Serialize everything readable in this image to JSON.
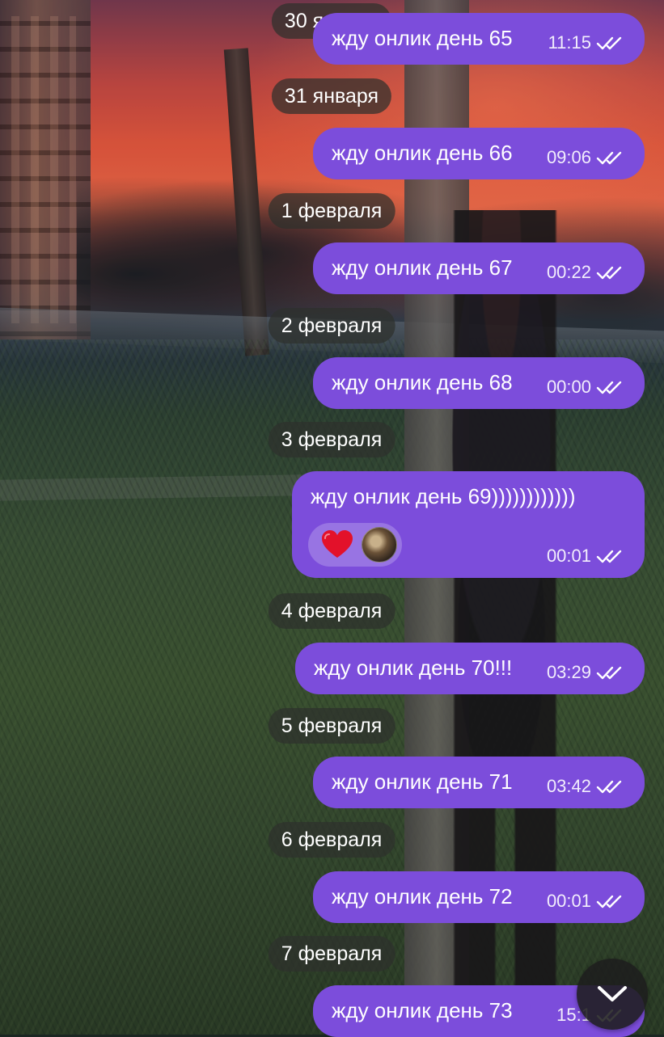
{
  "chat": {
    "entries": [
      {
        "date": "30 января",
        "message": "жду онлик день 65",
        "time": "11:15",
        "status": "read"
      },
      {
        "date": "31 января",
        "message": "жду онлик день 66",
        "time": "09:06",
        "status": "read"
      },
      {
        "date": "1 февраля",
        "message": "жду онлик день 67",
        "time": "00:22",
        "status": "read"
      },
      {
        "date": "2 февраля",
        "message": "жду онлик день 68",
        "time": "00:00",
        "status": "read"
      },
      {
        "date": "3 февраля",
        "message": "жду онлик день 69))))))))))))",
        "time": "00:01",
        "status": "read",
        "reaction": "❤️"
      },
      {
        "date": "4 февраля",
        "message": "жду онлик день 70!!!",
        "time": "03:29",
        "status": "read"
      },
      {
        "date": "5 февраля",
        "message": "жду онлик день 71",
        "time": "03:42",
        "status": "read"
      },
      {
        "date": "6 февраля",
        "message": "жду онлик день 72",
        "time": "00:01",
        "status": "read"
      },
      {
        "date": "7 февраля",
        "message": "жду онлик день 73",
        "time": "15:1",
        "status": "read"
      }
    ]
  },
  "colors": {
    "bubble": "#7c4ddb",
    "date_pill": "rgba(46,48,44,0.72)",
    "scroll_button": "#1e1e1e"
  },
  "icons": {
    "read_status": "double-check-icon",
    "scroll_down": "chevron-down-icon",
    "reaction": "heart-icon"
  }
}
